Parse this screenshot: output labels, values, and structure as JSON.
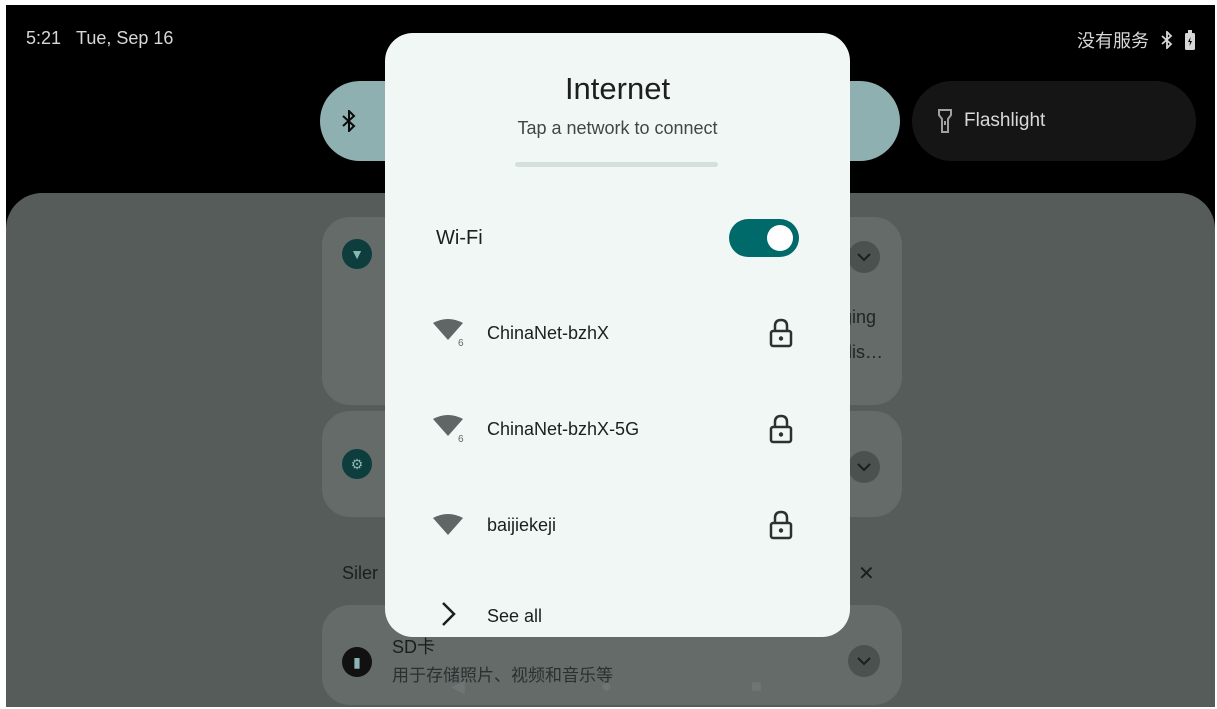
{
  "status_bar": {
    "time": "5:21",
    "date": "Tue, Sep 16",
    "carrier": "没有服务",
    "bluetooth_icon": "bluetooth-icon",
    "battery_icon": "battery-icon"
  },
  "quick_settings": {
    "tiles": [
      {
        "icon": "bluetooth-icon",
        "label": ""
      },
      {
        "icon": "flashlight-icon",
        "label": "Flashlight"
      }
    ]
  },
  "notifications": {
    "item1_peek_line1": "ging",
    "item1_peek_line2": "dis…",
    "section_label": "Siler",
    "sd_card_title": "SD卡",
    "sd_card_subtitle": "用于存储照片、视频和音乐等"
  },
  "dialog": {
    "title": "Internet",
    "subtitle": "Tap a network to connect",
    "wifi_label": "Wi-Fi",
    "wifi_enabled": true,
    "networks": [
      {
        "name": "ChinaNet-bzhX",
        "badge": "6",
        "locked": true,
        "icon": "wifi-icon"
      },
      {
        "name": "ChinaNet-bzhX-5G",
        "badge": "6",
        "locked": true,
        "icon": "wifi-icon"
      },
      {
        "name": "baijiekeji",
        "badge": "",
        "locked": true,
        "icon": "wifi-icon"
      }
    ],
    "see_all": "See all"
  },
  "colors": {
    "accent": "#006a6a",
    "dialog_bg": "#f1f7f5",
    "scrim": "#555c5a"
  }
}
